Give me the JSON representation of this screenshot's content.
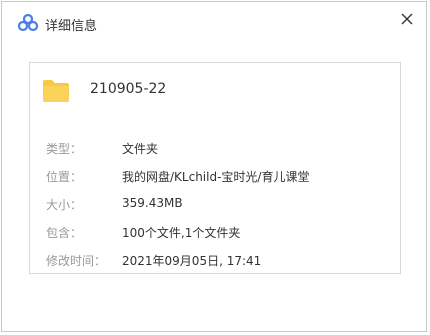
{
  "window": {
    "title": "详细信息",
    "logo_icon": "cloud-logo-icon",
    "close_icon": "close-icon"
  },
  "file": {
    "icon": "folder-icon",
    "icon_color": "#f9c846",
    "name": "210905-22"
  },
  "details": [
    {
      "label": "类型：",
      "value": "文件夹"
    },
    {
      "label": "位置：",
      "value": "我的网盘/KLchild-宝时光/育儿课堂"
    },
    {
      "label": "大小：",
      "value": "359.43MB"
    },
    {
      "label": "包含：",
      "value": "100个文件,1个文件夹"
    },
    {
      "label": "修改时间：",
      "value": "2021年09月05日, 17:41"
    }
  ]
}
